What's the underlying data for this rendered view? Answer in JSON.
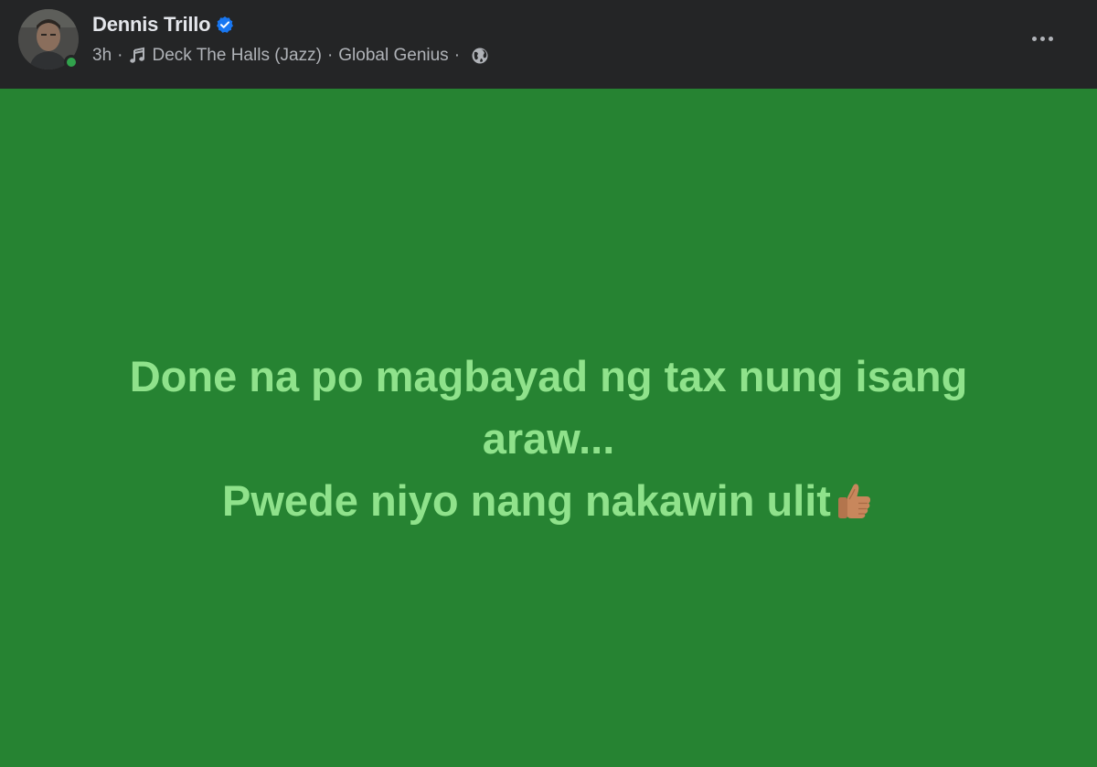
{
  "post": {
    "author": {
      "name": "Dennis Trillo",
      "avatar_icon": "profile-photo",
      "verified_icon": "verified-badge-icon",
      "online": true
    },
    "meta": {
      "time": "3h",
      "separator": "·",
      "music_icon": "music-note-icon",
      "song": "Deck The Halls (Jazz)",
      "artist": "Global Genius",
      "audience_icon": "globe-icon"
    },
    "more_icon": "more-options-icon",
    "body": {
      "background_color": "#268332",
      "text_color": "#8fe28b",
      "line1": "Done na po magbayad ng tax nung isang araw...",
      "line2": "Pwede niyo nang nakawin ulit",
      "emoji_icon": "thumbs-up-icon"
    }
  }
}
